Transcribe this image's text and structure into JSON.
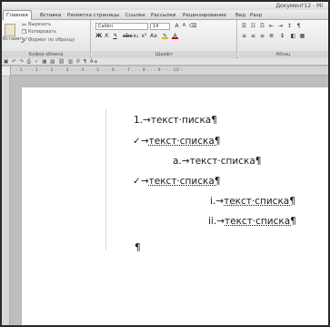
{
  "window": {
    "title": "Документ12 - Mi"
  },
  "tabs": [
    "Главная",
    "Вставка",
    "Разметка страницы",
    "Ссылки",
    "Рассылки",
    "Рецензирование",
    "Вид",
    "Разр"
  ],
  "ribbon": {
    "clipboard": {
      "paste_label": "Вставить",
      "cut_label": "Вырезать",
      "copy_label": "Копировать",
      "format_painter_label": "Формат по образцу",
      "group_label": "Буфер обмена"
    },
    "font": {
      "font_name": "Calibri",
      "font_size": "14",
      "group_label": "Шрифт",
      "bold": "Ж",
      "italic": "К",
      "underline": "Ч"
    },
    "paragraph": {
      "group_label": "Абзац"
    }
  },
  "document": {
    "lines": [
      {
        "marker": "1.",
        "tab": "→",
        "text": "текст·писка¶"
      },
      {
        "marker": "✓",
        "tab": "→",
        "text": "текст·списка¶"
      },
      {
        "marker": "a.",
        "tab": "→",
        "text": "текст·списка¶"
      },
      {
        "marker": "✓",
        "tab": "→",
        "text": "текст·списка¶"
      },
      {
        "marker": "i.",
        "tab": "→",
        "text": "текст·списка¶"
      },
      {
        "marker": "ii.",
        "tab": "→",
        "text": "текст·списка¶"
      },
      {
        "marker": "",
        "tab": "",
        "text": "¶"
      }
    ]
  }
}
